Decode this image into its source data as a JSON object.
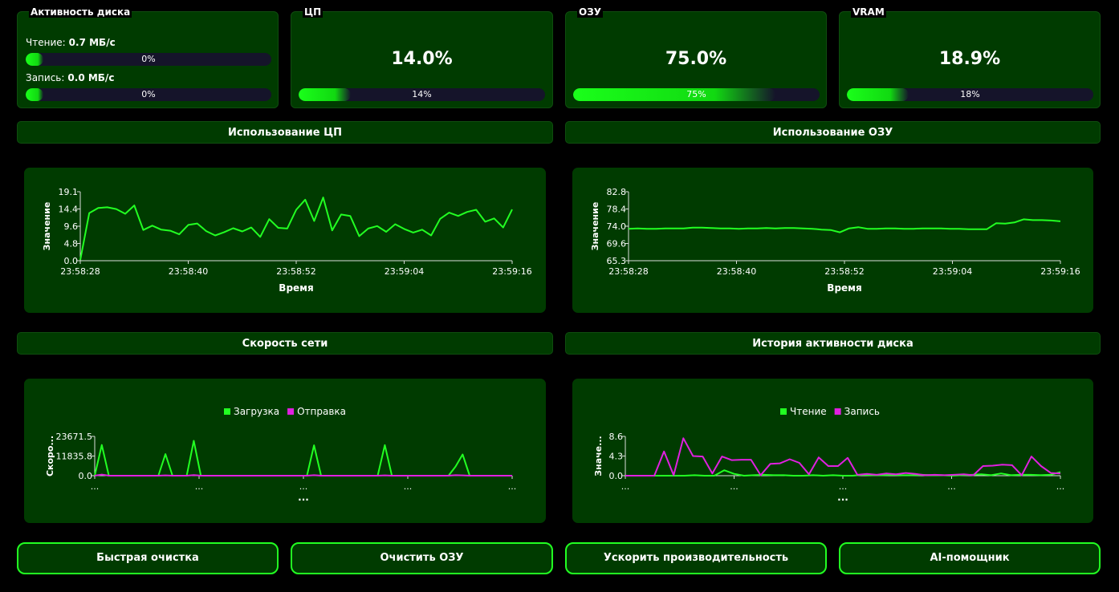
{
  "disk": {
    "title": "Активность диска",
    "read_label": "Чтение:",
    "read_value": "0.7 МБ/с",
    "read_percent_text": "0%",
    "read_percent": 0,
    "write_label": "Запись:",
    "write_value": "0.0 МБ/с",
    "write_percent_text": "0%",
    "write_percent": 0
  },
  "cpu": {
    "title": "ЦП",
    "value": "14.0%",
    "percent_text": "14%",
    "percent": 14
  },
  "ram": {
    "title": "ОЗУ",
    "value": "75.0%",
    "percent_text": "75%",
    "percent": 75
  },
  "vram": {
    "title": "VRAM",
    "value": "18.9%",
    "percent_text": "18%",
    "percent": 18
  },
  "sections": {
    "cpu_usage": "Использование ЦП",
    "ram_usage": "Использование ОЗУ",
    "network_speed": "Скорость сети",
    "disk_history": "История активности диска"
  },
  "colors": {
    "accent": "#22ff22",
    "card": "#003b00",
    "magenta": "#e020e0",
    "track": "#15142a"
  },
  "chart_data": [
    {
      "type": "line",
      "xlabel": "Время",
      "ylabel": "Значение",
      "ylim": [
        0,
        19.1
      ],
      "yticks": [
        "0.0",
        "4.8",
        "9.6",
        "14.4",
        "19.1"
      ],
      "xticks": [
        "23:58:28",
        "23:58:40",
        "23:58:52",
        "23:59:04",
        "23:59:16"
      ],
      "series": [
        {
          "color": "#22ff22",
          "values": [
            0.2,
            13.2,
            14.6,
            14.8,
            14.3,
            13.0,
            15.3,
            8.5,
            9.7,
            8.6,
            8.3,
            7.3,
            9.9,
            10.3,
            8.2,
            7.0,
            7.9,
            9.0,
            8.1,
            9.2,
            6.6,
            11.5,
            9.1,
            8.9,
            14.1,
            16.9,
            11.0,
            17.5,
            8.4,
            12.8,
            12.4,
            6.8,
            8.9,
            9.6,
            8.0,
            10.1,
            8.8,
            7.8,
            8.6,
            7.0,
            11.6,
            13.3,
            12.4,
            13.5,
            14.1,
            10.8,
            11.7,
            9.2,
            14.2
          ]
        }
      ]
    },
    {
      "type": "line",
      "xlabel": "Время",
      "ylabel": "Значение",
      "ylim": [
        65.3,
        82.8
      ],
      "yticks": [
        "65.3",
        "69.6",
        "74.0",
        "78.4",
        "82.8"
      ],
      "xticks": [
        "23:58:28",
        "23:58:40",
        "23:58:52",
        "23:59:04",
        "23:59:16"
      ],
      "series": [
        {
          "color": "#22ff22",
          "values": [
            73.4,
            73.5,
            73.4,
            73.4,
            73.5,
            73.5,
            73.5,
            73.7,
            73.7,
            73.6,
            73.5,
            73.5,
            73.4,
            73.5,
            73.5,
            73.6,
            73.5,
            73.6,
            73.6,
            73.5,
            73.4,
            73.2,
            73.1,
            72.5,
            73.5,
            73.8,
            73.4,
            73.4,
            73.5,
            73.5,
            73.4,
            73.4,
            73.5,
            73.5,
            73.5,
            73.4,
            73.4,
            73.3,
            73.3,
            73.3,
            74.8,
            74.7,
            75.0,
            75.8,
            75.6,
            75.6,
            75.5,
            75.3
          ]
        }
      ]
    },
    {
      "type": "line",
      "ylabel": "Скоро...",
      "xlabel": "...",
      "ylim": [
        0,
        23671.5
      ],
      "yticks": [
        "0.0",
        "11835.8",
        "23671.5"
      ],
      "xticks": [
        "...",
        "...",
        "...",
        "...",
        "..."
      ],
      "legend": [
        {
          "label": "Загрузка",
          "color": "#22ff22"
        },
        {
          "label": "Отправка",
          "color": "#e020e0"
        }
      ],
      "series": [
        {
          "name": "Загрузка",
          "color": "#22ff22",
          "values": [
            0,
            18500,
            0,
            0,
            0,
            0,
            0,
            0,
            0,
            0,
            13000,
            0,
            0,
            0,
            21000,
            0,
            0,
            0,
            0,
            0,
            0,
            0,
            0,
            0,
            0,
            0,
            0,
            0,
            0,
            0,
            0,
            18300,
            0,
            0,
            0,
            0,
            0,
            0,
            0,
            0,
            0,
            18400,
            0,
            0,
            0,
            0,
            0,
            0,
            0,
            0,
            0,
            5500,
            12800,
            0,
            0,
            0,
            0,
            0,
            0,
            0
          ]
        },
        {
          "name": "Отправка",
          "color": "#e020e0",
          "values": [
            0,
            700,
            0,
            0,
            0,
            0,
            0,
            0,
            0,
            0,
            200,
            0,
            0,
            0,
            400,
            0,
            0,
            0,
            0,
            0,
            0,
            0,
            0,
            0,
            0,
            0,
            0,
            0,
            0,
            0,
            0,
            300,
            0,
            0,
            0,
            0,
            0,
            0,
            0,
            0,
            0,
            200,
            0,
            0,
            0,
            0,
            0,
            0,
            0,
            0,
            0,
            300,
            200,
            0,
            0,
            0,
            0,
            0,
            0,
            0
          ]
        }
      ]
    },
    {
      "type": "line",
      "ylabel": "Значе...",
      "xlabel": "...",
      "ylim": [
        0,
        8.6
      ],
      "yticks": [
        "0.0",
        "4.3",
        "8.6"
      ],
      "xticks": [
        "...",
        "...",
        "...",
        "...",
        "..."
      ],
      "legend": [
        {
          "label": "Чтение",
          "color": "#22ff22"
        },
        {
          "label": "Запись",
          "color": "#e020e0"
        }
      ],
      "series": [
        {
          "name": "Чтение",
          "color": "#22ff22",
          "values": [
            0,
            0,
            0,
            0,
            0,
            0,
            0,
            0.1,
            0,
            0,
            1.2,
            0.4,
            0,
            0.1,
            0.2,
            0.1,
            0.1,
            0,
            0,
            0.1,
            0,
            0.1,
            0,
            0,
            0.2,
            0.1,
            0.1,
            0.2,
            0.1,
            0.1,
            0.2,
            0.1,
            0.1,
            0,
            0.1,
            0.2,
            0.3,
            0.1,
            0.5,
            0.1,
            0.2,
            0.2,
            0.1,
            0.2,
            0.8
          ]
        },
        {
          "name": "Запись",
          "color": "#e020e0",
          "values": [
            0,
            0,
            0,
            0,
            5.3,
            0.1,
            8.2,
            4.3,
            4.2,
            0.5,
            4.2,
            3.4,
            3.5,
            3.5,
            0.1,
            2.6,
            2.7,
            3.6,
            2.8,
            0.3,
            4.0,
            2.1,
            2.1,
            3.9,
            0.2,
            0.4,
            0.2,
            0.5,
            0.3,
            0.6,
            0.4,
            0.1,
            0.2,
            0.1,
            0.2,
            0.3,
            0.1,
            2.1,
            2.2,
            2.4,
            2.3,
            0.1,
            4.2,
            2.1,
            0.6,
            0.5
          ]
        }
      ]
    }
  ],
  "buttons": {
    "quick_clean": "Быстрая очистка",
    "clear_ram": "Очистить ОЗУ",
    "boost": "Ускорить производительность",
    "ai": "AI-помощник"
  }
}
